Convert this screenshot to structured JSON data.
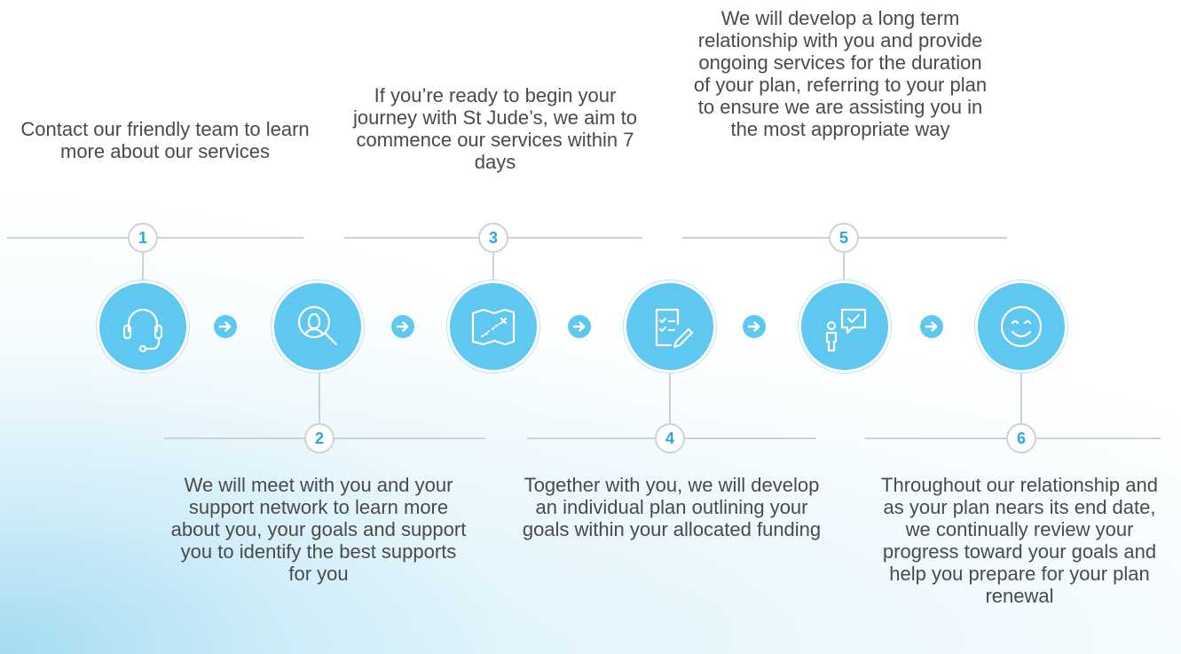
{
  "steps": [
    {
      "number": "1",
      "icon": "headset-icon",
      "text": "Contact our friendly team to learn more about our services"
    },
    {
      "number": "2",
      "icon": "person-search-icon",
      "text": "We will meet with you and your support network to learn more about you, your goals and support you to identify the best supports for you"
    },
    {
      "number": "3",
      "icon": "map-icon",
      "text": "If you’re ready to begin your journey with St Jude’s, we aim to commence our services within 7 days"
    },
    {
      "number": "4",
      "icon": "plan-document-icon",
      "text": "Together with you, we will develop an individual plan outlining your goals within your allocated funding"
    },
    {
      "number": "5",
      "icon": "person-chat-icon",
      "text": "We will develop a long term relationship with you and provide ongoing services for the duration of your plan, referring to your plan to ensure we are assisting you in the most appropriate way"
    },
    {
      "number": "6",
      "icon": "smiley-icon",
      "text": "Throughout our relationship and as your plan nears its end date, we continually review your progress toward your goals and help you prepare for your plan renewal"
    }
  ],
  "colors": {
    "circle_fill": "#5ec8f0",
    "number_text": "#2aa8d8",
    "connector_line": "#cfd2d4",
    "body_text": "#4a4a4a"
  }
}
